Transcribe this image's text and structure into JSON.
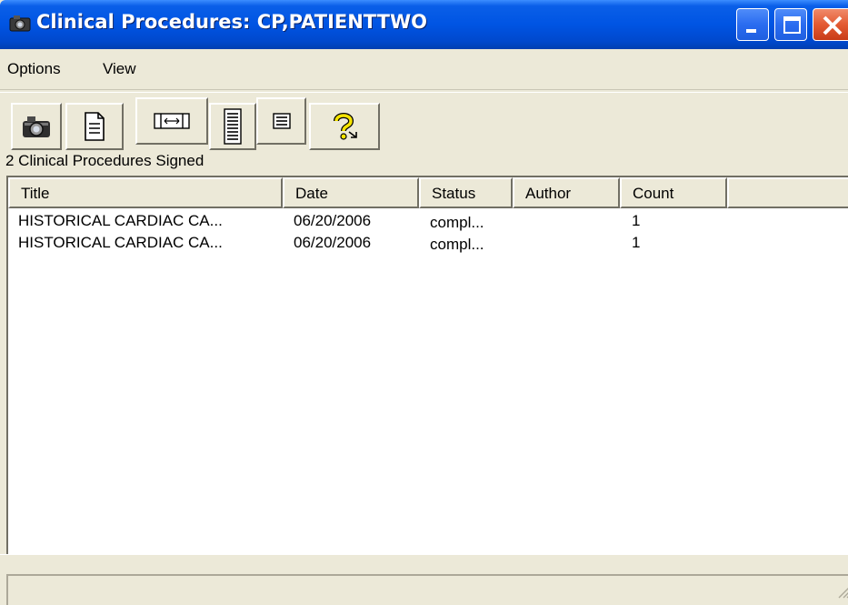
{
  "window": {
    "title": "Clinical Procedures: CP,PATIENTTWO",
    "controls": {
      "minimize": "minimize",
      "maximize": "maximize",
      "close": "close"
    }
  },
  "menu": {
    "items": [
      "Options",
      "View"
    ]
  },
  "toolbar": {
    "buttons": [
      {
        "name": "camera-icon"
      },
      {
        "name": "document-icon"
      },
      {
        "name": "expand-columns-icon"
      },
      {
        "name": "list-lines-icon"
      },
      {
        "name": "small-list-icon"
      },
      {
        "name": "help-icon"
      }
    ]
  },
  "caption": "2  Clinical Procedures Signed",
  "list": {
    "columns": [
      "Title",
      "Date",
      "Status",
      "Author",
      "Count"
    ],
    "rows": [
      {
        "title": "HISTORICAL CARDIAC CA...",
        "date": "06/20/2006",
        "status": "compl...",
        "author": "",
        "count": "1"
      },
      {
        "title": "HISTORICAL CARDIAC CA...",
        "date": "06/20/2006",
        "status": "compl...",
        "author": "",
        "count": "1"
      }
    ]
  },
  "colors": {
    "titlebar": "#0054e3",
    "face": "#ece9d8",
    "list_bg": "#ffffff"
  }
}
